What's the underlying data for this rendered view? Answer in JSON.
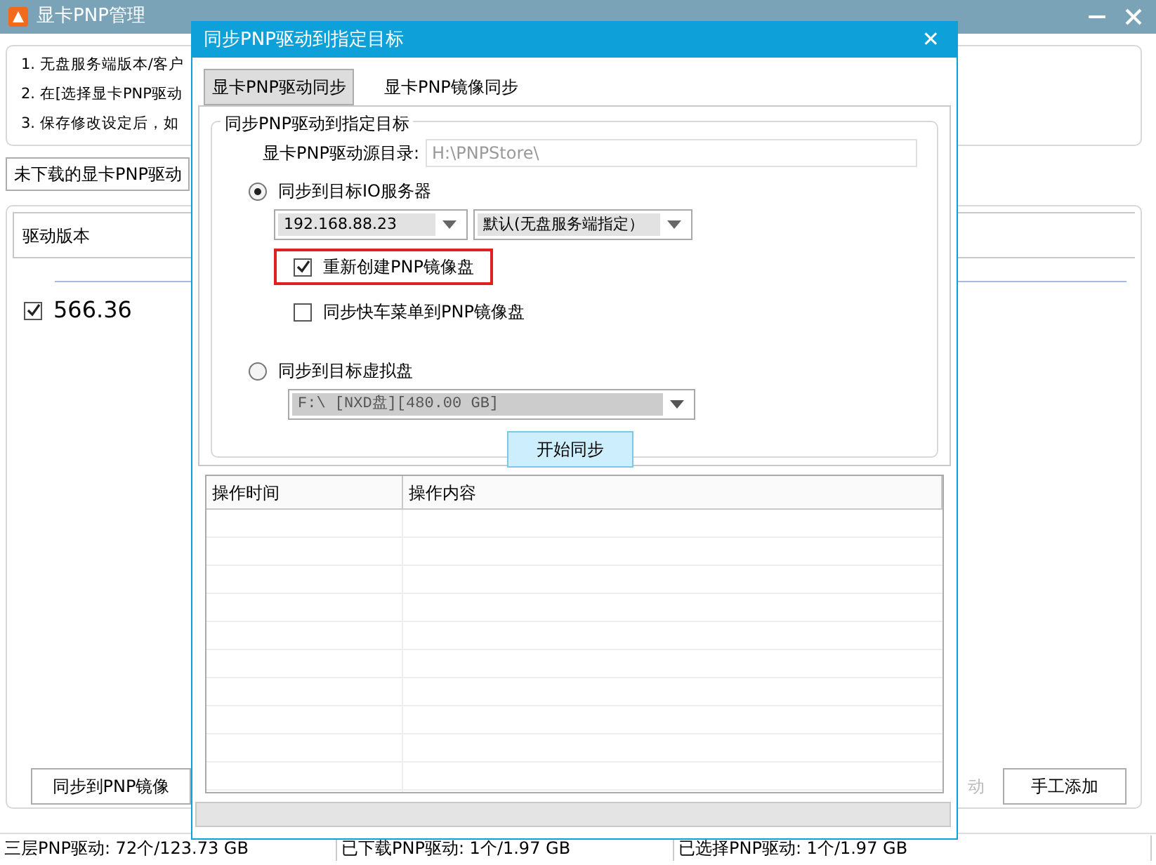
{
  "window": {
    "title": "显卡PNP管理"
  },
  "notes": [
    "1. 无盘服务端版本/客户",
    "2. 在[选择显卡PNP驱动",
    "3. 保存修改设定后，如"
  ],
  "undownloaded_button": "未下载的显卡PNP驱动",
  "driver_table": {
    "columns": [
      "驱动版本"
    ],
    "rows": [
      {
        "version": "566.36",
        "checked": true
      }
    ]
  },
  "bottom_buttons": [
    {
      "label": "同步到PNP镜像",
      "disabled": false
    },
    {
      "label": "动",
      "disabled": true
    },
    {
      "label": "手工添加",
      "disabled": false
    }
  ],
  "status_bar": [
    "三层PNP驱动: 72个/123.73 GB",
    "已下载PNP驱动: 1个/1.97 GB",
    "已选择PNP驱动: 1个/1.97 GB"
  ],
  "dialog": {
    "title": "同步PNP驱动到指定目标",
    "close": "✕",
    "tabs": [
      {
        "label": "显卡PNP驱动同步",
        "selected": true
      },
      {
        "label": "显卡PNP镜像同步",
        "selected": false
      }
    ],
    "group_title": "同步PNP驱动到指定目标",
    "source_label": "显卡PNP驱动源目录:",
    "source_value": "H:\\PNPStore\\",
    "targets": [
      {
        "label": "同步到目标IO服务器",
        "selected": true,
        "selects": [
          {
            "value": "192.168.88.23",
            "disabled": false
          },
          {
            "value": "默认(无盘服务端指定）",
            "disabled": false
          }
        ],
        "options": [
          {
            "label": "重新创建PNP镜像盘",
            "checked": true,
            "highlighted": true
          },
          {
            "label": "同步快车菜单到PNP镜像盘",
            "checked": false,
            "highlighted": false
          }
        ]
      },
      {
        "label": "同步到目标虚拟盘",
        "selected": false,
        "selects": [
          {
            "value": "F:\\ [NXD盘][480.00 GB]",
            "disabled": true
          }
        ]
      }
    ],
    "start_button": "开始同步",
    "log_table": {
      "columns": [
        "操作时间",
        "操作内容"
      ]
    }
  }
}
